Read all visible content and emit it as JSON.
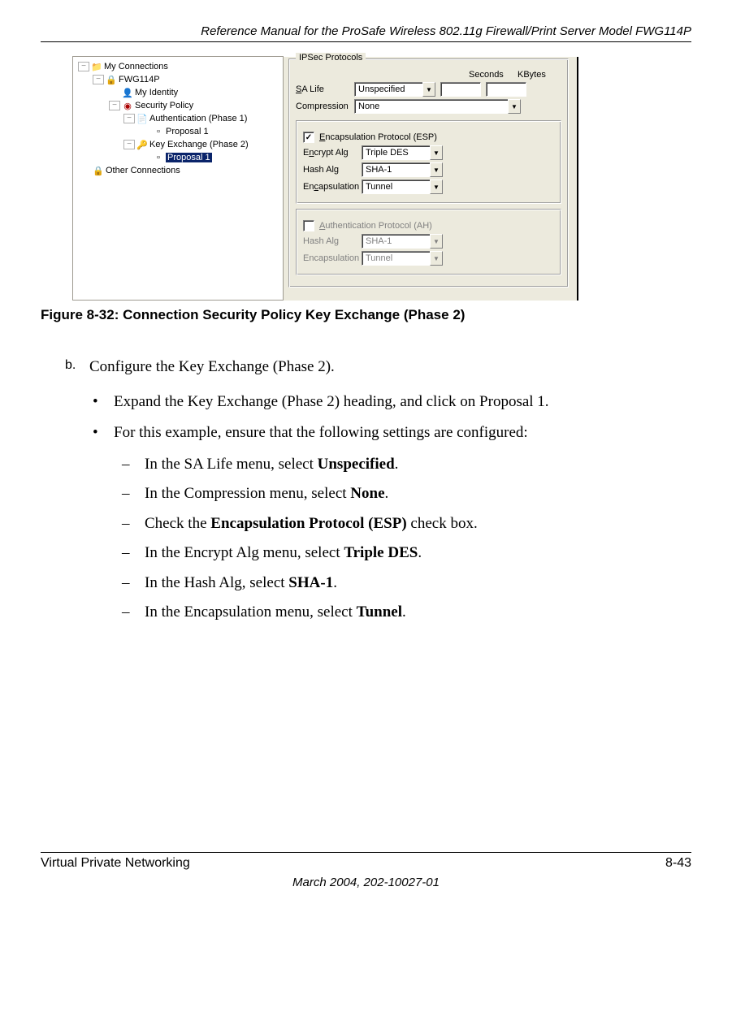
{
  "header": "Reference Manual for the ProSafe Wireless 802.11g  Firewall/Print Server Model FWG114P",
  "figure": {
    "tree": {
      "root": "My Connections",
      "conn": "FWG114P",
      "identity": "My Identity",
      "policy": "Security Policy",
      "auth": "Authentication (Phase 1)",
      "auth_prop": "Proposal 1",
      "key": "Key Exchange (Phase 2)",
      "key_prop": "Proposal 1",
      "other": "Other Connections"
    },
    "panel": {
      "group_title": "IPSec Protocols",
      "seconds": "Seconds",
      "kbytes": "KBytes",
      "sa_life_label": "SA Life",
      "sa_life_value": "Unspecified",
      "compression_label": "Compression",
      "compression_value": "None",
      "esp_cb_label": "Encapsulation Protocol (ESP)",
      "esp_checked": "✓",
      "encrypt_label": "Encrypt Alg",
      "encrypt_value": "Triple DES",
      "hash_label": "Hash Alg",
      "hash_value": "SHA-1",
      "encap_label": "Encapsulation",
      "encap_value": "Tunnel",
      "ah_cb_label": "Authentication Protocol (AH)",
      "ah_hash_label": "Hash Alg",
      "ah_hash_value": "SHA-1",
      "ah_encap_label": "Encapsulation",
      "ah_encap_value": "Tunnel"
    },
    "caption": "Figure 8-32:  Connection Security Policy Key Exchange (Phase 2)"
  },
  "body": {
    "step_letter": "b.",
    "step_text": "Configure the Key Exchange (Phase 2).",
    "bullet1": "Expand the Key Exchange (Phase 2) heading, and click on Proposal 1.",
    "bullet2": "For this example, ensure that the following settings are configured:",
    "dash1_pre": "In the SA Life menu, select ",
    "dash1_bold": "Unspecified",
    "dash1_post": ".",
    "dash2_pre": "In the Compression menu, select ",
    "dash2_bold": "None",
    "dash2_post": ".",
    "dash3_pre": "Check the ",
    "dash3_bold": "Encapsulation Protocol (ESP)",
    "dash3_post": " check box.",
    "dash4_pre": "In the Encrypt Alg menu, select ",
    "dash4_bold": "Triple DES",
    "dash4_post": ".",
    "dash5_pre": "In the Hash Alg, select ",
    "dash5_bold": "SHA-1",
    "dash5_post": ".",
    "dash6_pre": "In the Encapsulation menu, select ",
    "dash6_bold": "Tunnel",
    "dash6_post": "."
  },
  "footer": {
    "section": "Virtual Private Networking",
    "page": "8-43",
    "date": "March 2004, 202-10027-01"
  }
}
